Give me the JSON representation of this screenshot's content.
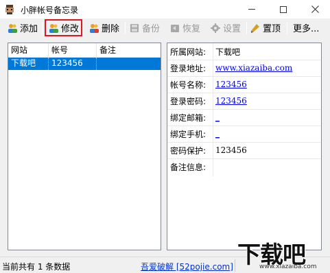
{
  "window": {
    "title": "小胖帐号备忘录"
  },
  "toolbar": {
    "add_label": "添加",
    "edit_label": "修改",
    "delete_label": "删除",
    "backup_label": "备份",
    "restore_label": "恢复",
    "settings_label": "设置",
    "pin_label": "置顶",
    "more_label": "更多..."
  },
  "list": {
    "columns": [
      "网站",
      "帐号",
      "备注"
    ],
    "rows": [
      {
        "site": "下载吧",
        "account": "123456",
        "note": ""
      }
    ]
  },
  "detail": {
    "site_label": "所属网站:",
    "site_value": "下载吧",
    "url_label": "登录地址:",
    "url_value": "www.xiazaiba.com",
    "name_label": "帐号名称:",
    "name_value": "123456",
    "password_label": "登录密码:",
    "password_value": "123456",
    "email_label": "绑定邮箱:",
    "email_value": "_",
    "phone_label": "绑定手机:",
    "phone_value": "_",
    "protect_label": "密码保护:",
    "protect_value": "123456",
    "note_label": "备注信息:"
  },
  "status": {
    "count_text": "当前共有 1 条数据",
    "link_text": "吾爱破解 [52pojie.com]"
  },
  "watermark": {
    "brand": "下载吧",
    "url": "www.xiazaiba.com"
  },
  "colors": {
    "selection": "#0078d7",
    "highlight_border": "#e0141e",
    "link": "#0000ee"
  }
}
